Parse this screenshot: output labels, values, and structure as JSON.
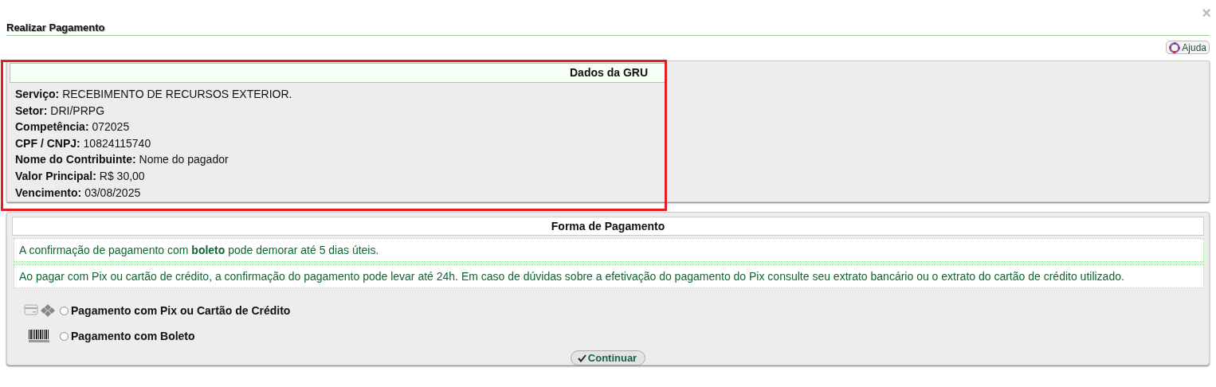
{
  "window": {
    "title": "Realizar Pagamento",
    "close": "×"
  },
  "help_button": {
    "label": "Ajuda"
  },
  "gru": {
    "title": "Dados da GRU",
    "highlighted": true,
    "fields": [
      {
        "label": "Serviço:",
        "value": "RECEBIMENTO DE RECURSOS EXTERIOR."
      },
      {
        "label": "Setor:",
        "value": "DRI/PRPG"
      },
      {
        "label": "Competência:",
        "value": "072025"
      },
      {
        "label": "CPF / CNPJ:",
        "value": "10824115740"
      },
      {
        "label": "Nome do Contribuinte:",
        "value": "Nome do pagador"
      },
      {
        "label": "Valor Principal:",
        "value": "R$ 30,00"
      },
      {
        "label": "Vencimento:",
        "value": "03/08/2025"
      }
    ]
  },
  "payment": {
    "title": "Forma de Pagamento",
    "notices": [
      "A confirmação de pagamento com **boleto** pode demorar até 5 dias úteis.",
      "Ao pagar com Pix ou cartão de crédito, a confirmação do pagamento pode levar até 24h. Em caso de dúvidas sobre a efetivação do pagamento do Pix consulte seu extrato bancário ou o extrato do cartão de crédito utilizado."
    ],
    "options": [
      {
        "kind": "pix_card",
        "label": "Pagamento com Pix ou Cartão de Crédito",
        "selected": false
      },
      {
        "kind": "boleto",
        "label": "Pagamento com Boleto",
        "selected": false
      }
    ],
    "submit": {
      "label": "Continuar"
    }
  }
}
